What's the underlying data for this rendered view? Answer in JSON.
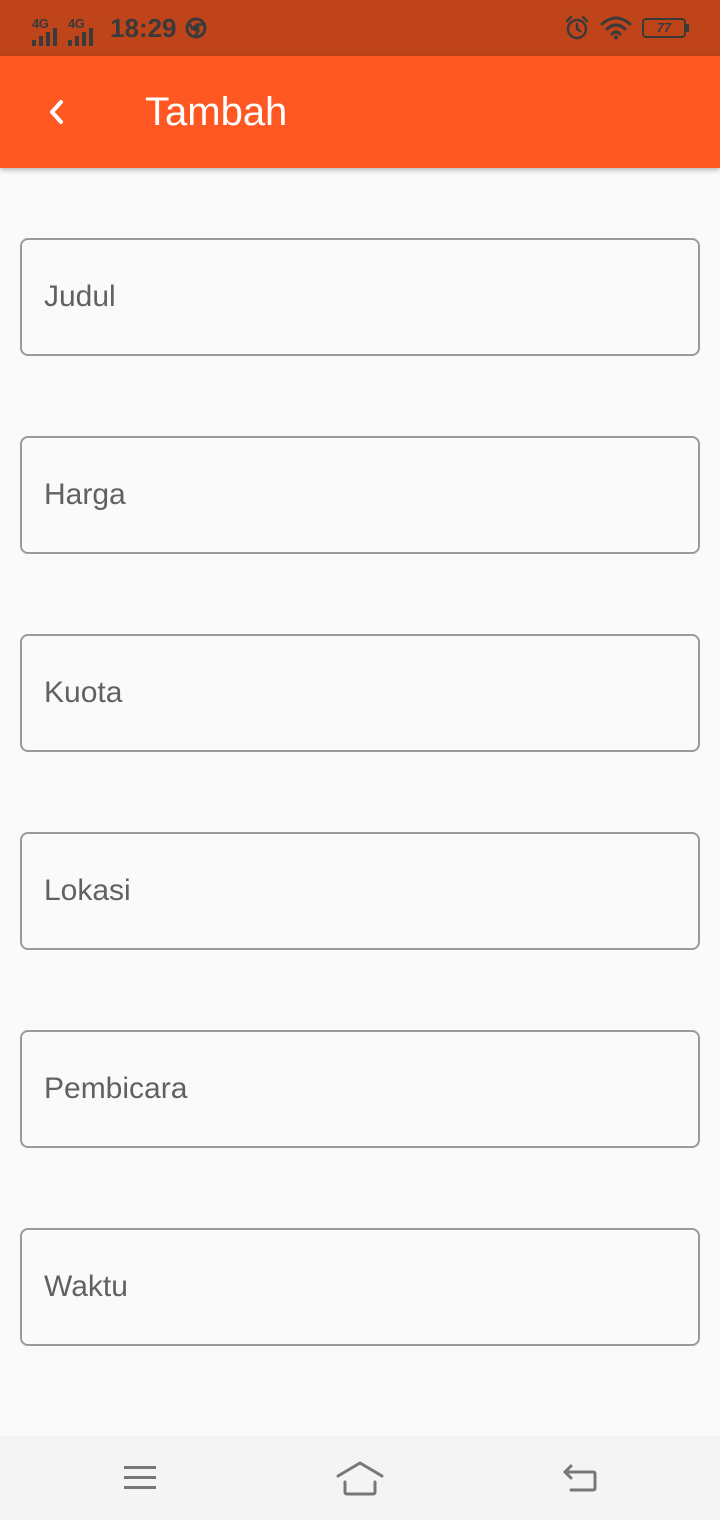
{
  "status_bar": {
    "signal_1": "4G",
    "signal_2": "4G",
    "time": "18:29",
    "battery": "77"
  },
  "app_bar": {
    "title": "Tambah",
    "back_icon": "chevron-left-icon"
  },
  "form": {
    "fields": [
      {
        "placeholder": "Judul",
        "value": ""
      },
      {
        "placeholder": "Harga",
        "value": ""
      },
      {
        "placeholder": "Kuota",
        "value": ""
      },
      {
        "placeholder": "Lokasi",
        "value": ""
      },
      {
        "placeholder": "Pembicara",
        "value": ""
      },
      {
        "placeholder": "Waktu",
        "value": ""
      }
    ]
  },
  "nav_bar": {
    "icons": [
      "menu-icon",
      "home-icon",
      "back-icon"
    ]
  },
  "colors": {
    "status_bar": "#bf4419",
    "app_bar": "#ff5722",
    "background": "#fafafa",
    "field_border": "#9a9a9a",
    "placeholder_text": "#616161"
  }
}
